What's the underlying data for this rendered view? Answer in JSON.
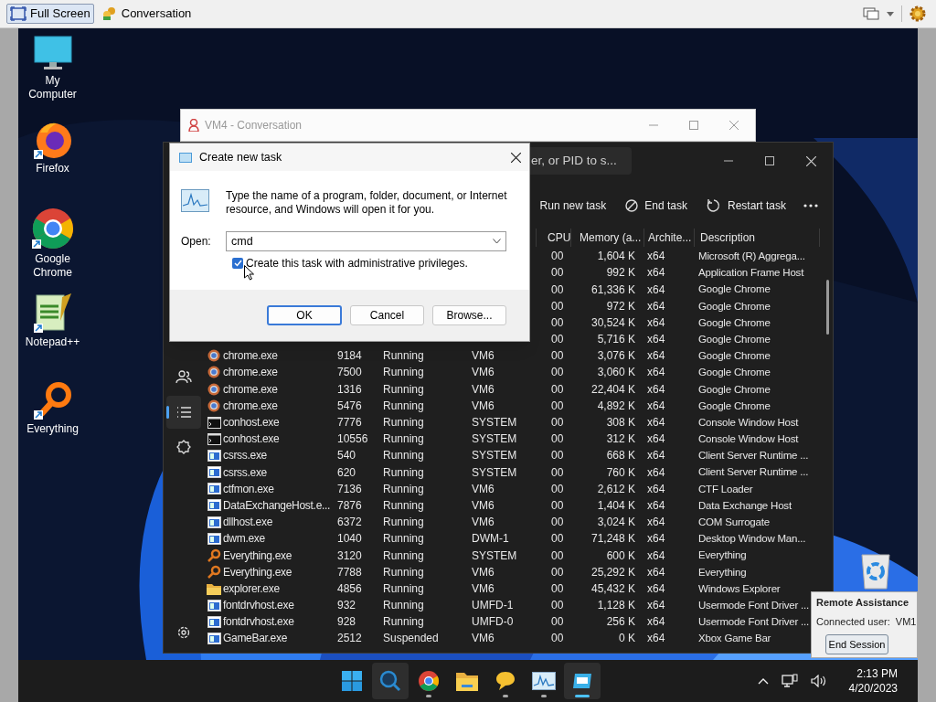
{
  "top_bar": {
    "buttons": [
      {
        "label": "Full Screen",
        "kind": "fullscreen",
        "selected": true
      },
      {
        "label": "Conversation",
        "kind": "conversation",
        "selected": false
      }
    ]
  },
  "desktop_icons": [
    {
      "label": "My Computer",
      "kind": "computer"
    },
    {
      "label": "Firefox",
      "kind": "firefox"
    },
    {
      "label": "Google Chrome",
      "kind": "chrome"
    },
    {
      "label": "Notepad++",
      "kind": "notepad"
    },
    {
      "label": "Everything",
      "kind": "everything"
    }
  ],
  "background_window": {
    "title": "VM4 - Conversation"
  },
  "task_manager": {
    "search": {
      "placeholder": "er, or PID to s..."
    },
    "commands": [
      {
        "label": "Run new task",
        "kind": "run"
      },
      {
        "label": "End task",
        "kind": "end"
      },
      {
        "label": "Restart task",
        "kind": "restart"
      }
    ],
    "nav": [
      {
        "kind": "users",
        "selected": false
      },
      {
        "kind": "details",
        "selected": true
      },
      {
        "kind": "services",
        "selected": false
      }
    ],
    "columns": [
      "CPU",
      "Memory (a...",
      "Archite...",
      "Description"
    ],
    "rows": [
      {
        "cpu": "00",
        "memory": "1,604 K",
        "arch": "x64",
        "description": "Microsoft (R) Aggrega..."
      },
      {
        "cpu": "00",
        "memory": "992 K",
        "arch": "x64",
        "description": "Application Frame Host"
      },
      {
        "cpu": "00",
        "memory": "61,336 K",
        "arch": "x64",
        "description": "Google Chrome"
      },
      {
        "cpu": "00",
        "memory": "972 K",
        "arch": "x64",
        "description": "Google Chrome"
      },
      {
        "cpu": "00",
        "memory": "30,524 K",
        "arch": "x64",
        "description": "Google Chrome"
      },
      {
        "cpu": "00",
        "memory": "5,716 K",
        "arch": "x64",
        "description": "Google Chrome"
      },
      {
        "kind": "chrome",
        "name": "chrome.exe",
        "pid": "9184",
        "status": "Running",
        "user": "VM6",
        "cpu": "00",
        "memory": "3,076 K",
        "arch": "x64",
        "description": "Google Chrome"
      },
      {
        "kind": "chrome",
        "name": "chrome.exe",
        "pid": "7500",
        "status": "Running",
        "user": "VM6",
        "cpu": "00",
        "memory": "3,060 K",
        "arch": "x64",
        "description": "Google Chrome"
      },
      {
        "kind": "chrome",
        "name": "chrome.exe",
        "pid": "1316",
        "status": "Running",
        "user": "VM6",
        "cpu": "00",
        "memory": "22,404 K",
        "arch": "x64",
        "description": "Google Chrome"
      },
      {
        "kind": "chrome",
        "name": "chrome.exe",
        "pid": "5476",
        "status": "Running",
        "user": "VM6",
        "cpu": "00",
        "memory": "4,892 K",
        "arch": "x64",
        "description": "Google Chrome"
      },
      {
        "kind": "console",
        "name": "conhost.exe",
        "pid": "7776",
        "status": "Running",
        "user": "SYSTEM",
        "cpu": "00",
        "memory": "308 K",
        "arch": "x64",
        "description": "Console Window Host"
      },
      {
        "kind": "console",
        "name": "conhost.exe",
        "pid": "10556",
        "status": "Running",
        "user": "SYSTEM",
        "cpu": "00",
        "memory": "312 K",
        "arch": "x64",
        "description": "Console Window Host"
      },
      {
        "kind": "app",
        "name": "csrss.exe",
        "pid": "540",
        "status": "Running",
        "user": "SYSTEM",
        "cpu": "00",
        "memory": "668 K",
        "arch": "x64",
        "description": "Client Server Runtime ..."
      },
      {
        "kind": "app",
        "name": "csrss.exe",
        "pid": "620",
        "status": "Running",
        "user": "SYSTEM",
        "cpu": "00",
        "memory": "760 K",
        "arch": "x64",
        "description": "Client Server Runtime ..."
      },
      {
        "kind": "app",
        "name": "ctfmon.exe",
        "pid": "7136",
        "status": "Running",
        "user": "VM6",
        "cpu": "00",
        "memory": "2,612 K",
        "arch": "x64",
        "description": "CTF Loader"
      },
      {
        "kind": "app",
        "name": "DataExchangeHost.e...",
        "pid": "7876",
        "status": "Running",
        "user": "VM6",
        "cpu": "00",
        "memory": "1,404 K",
        "arch": "x64",
        "description": "Data Exchange Host"
      },
      {
        "kind": "app",
        "name": "dllhost.exe",
        "pid": "6372",
        "status": "Running",
        "user": "VM6",
        "cpu": "00",
        "memory": "3,024 K",
        "arch": "x64",
        "description": "COM Surrogate"
      },
      {
        "kind": "app",
        "name": "dwm.exe",
        "pid": "1040",
        "status": "Running",
        "user": "DWM-1",
        "cpu": "00",
        "memory": "71,248 K",
        "arch": "x64",
        "description": "Desktop Window Man..."
      },
      {
        "kind": "everything",
        "name": "Everything.exe",
        "pid": "3120",
        "status": "Running",
        "user": "SYSTEM",
        "cpu": "00",
        "memory": "600 K",
        "arch": "x64",
        "description": "Everything"
      },
      {
        "kind": "everything",
        "name": "Everything.exe",
        "pid": "7788",
        "status": "Running",
        "user": "VM6",
        "cpu": "00",
        "memory": "25,292 K",
        "arch": "x64",
        "description": "Everything"
      },
      {
        "kind": "folder",
        "name": "explorer.exe",
        "pid": "4856",
        "status": "Running",
        "user": "VM6",
        "cpu": "00",
        "memory": "45,432 K",
        "arch": "x64",
        "description": "Windows Explorer"
      },
      {
        "kind": "app",
        "name": "fontdrvhost.exe",
        "pid": "932",
        "status": "Running",
        "user": "UMFD-1",
        "cpu": "00",
        "memory": "1,128 K",
        "arch": "x64",
        "description": "Usermode Font Driver ..."
      },
      {
        "kind": "app",
        "name": "fontdrvhost.exe",
        "pid": "928",
        "status": "Running",
        "user": "UMFD-0",
        "cpu": "00",
        "memory": "256 K",
        "arch": "x64",
        "description": "Usermode Font Driver ..."
      },
      {
        "kind": "app",
        "name": "GameBar.exe",
        "pid": "2512",
        "status": "Suspended",
        "user": "VM6",
        "cpu": "00",
        "memory": "0 K",
        "arch": "x64",
        "description": "Xbox Game Bar"
      }
    ]
  },
  "dialog": {
    "title": "Create new task",
    "message": "Type the name of a program, folder, document, or Internet resource, and Windows will open it for you.",
    "open_label": "Open:",
    "open_value": "cmd",
    "admin_checkbox": {
      "label": "Create this task with administrative privileges.",
      "checked": true
    },
    "buttons": [
      {
        "label": "OK",
        "kind": "default"
      },
      {
        "label": "Cancel",
        "kind": "normal"
      },
      {
        "label": "Browse...",
        "kind": "normal"
      }
    ]
  },
  "remote_assistance": {
    "title": "Remote Assistance",
    "status": "Connected user:  VM1",
    "button": "End Session"
  },
  "taskbar": {
    "apps": [
      {
        "kind": "start",
        "running": false,
        "active": false
      },
      {
        "kind": "search",
        "running": false,
        "active": false
      },
      {
        "kind": "chrome",
        "running": true,
        "active": false
      },
      {
        "kind": "folder",
        "running": false,
        "active": false
      },
      {
        "kind": "chat",
        "running": true,
        "active": false
      },
      {
        "kind": "monitor",
        "running": true,
        "active": false
      },
      {
        "kind": "remote",
        "running": false,
        "active": true
      }
    ],
    "time": "2:13 PM",
    "date": "4/20/2023"
  }
}
